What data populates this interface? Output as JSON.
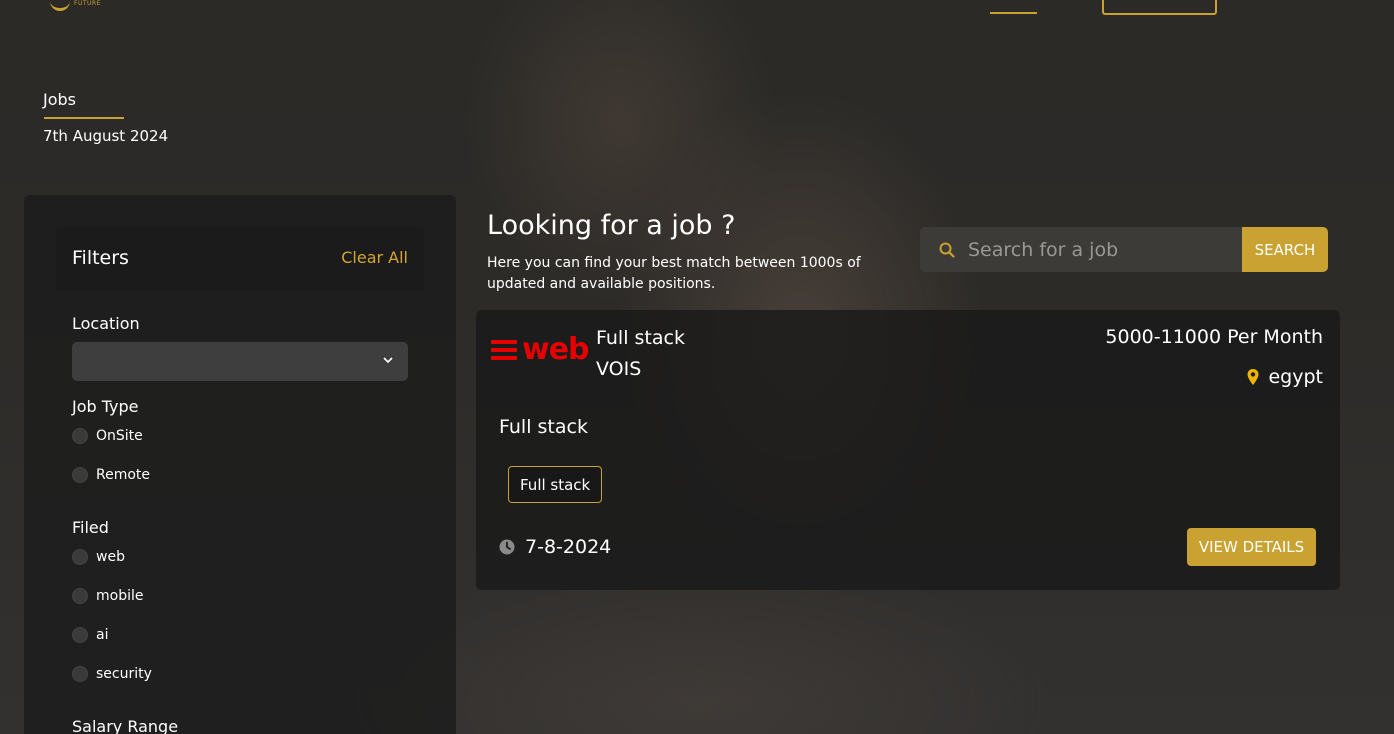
{
  "logo": {
    "small_text": "FUTURE"
  },
  "breadcrumb": {
    "title": "Jobs",
    "date": "7th August 2024"
  },
  "filters": {
    "title": "Filters",
    "clear_all": "Clear All",
    "location_label": "Location",
    "location_value": "",
    "job_type_label": "Job Type",
    "job_types": [
      "OnSite",
      "Remote"
    ],
    "field_label": "Filed",
    "fields": [
      "web",
      "mobile",
      "ai",
      "security"
    ],
    "salary_label": "Salary Range"
  },
  "hero": {
    "heading": "Looking for a job ?",
    "subtitle": "Here you can find your best match between 1000s of updated and available positions."
  },
  "search": {
    "placeholder": "Search for a job",
    "button": "SEARCH"
  },
  "job": {
    "logo_text": "web",
    "title": "Full stack",
    "company": "VOIS",
    "salary": "5000-11000 Per Month",
    "location": "egypt",
    "description": "Full stack",
    "tag": "Full stack",
    "date": "7-8-2024",
    "view_details": "VIEW DETAILS"
  },
  "colors": {
    "accent": "#c9a232",
    "brand_red": "#e60000"
  },
  "icons": [
    "chevron-down-icon",
    "search-icon",
    "location-pin-icon",
    "clock-icon"
  ]
}
